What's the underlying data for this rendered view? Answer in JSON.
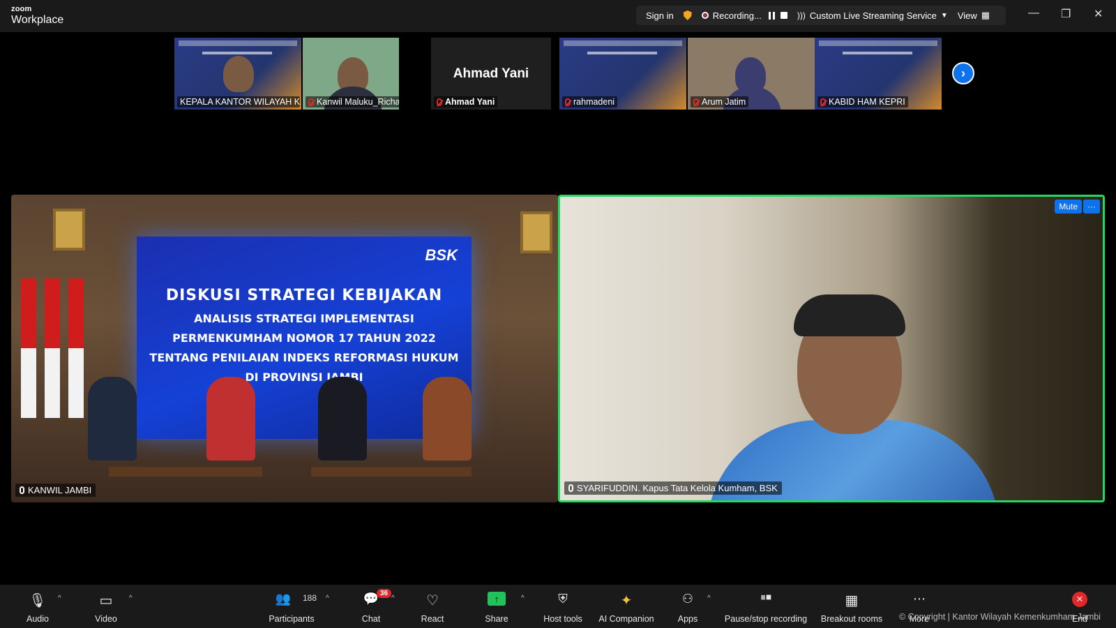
{
  "app": {
    "brand_top": "zoom",
    "brand_bottom": "Workplace"
  },
  "topbar": {
    "signin": "Sign in",
    "recording": "Recording...",
    "stream": "Custom Live Streaming Service",
    "view": "View"
  },
  "thumbnails": [
    {
      "name": "KEPALA KANTOR WILAYAH K...",
      "kind": "slide"
    },
    {
      "name": "Kanwil Maluku_Richard N...",
      "kind": "person"
    },
    {
      "name": "Ahmad Yani",
      "kind": "text",
      "display": "Ahmad Yani"
    },
    {
      "name": "rahmadeni",
      "kind": "slide"
    },
    {
      "name": "Arum Jatim",
      "kind": "person"
    },
    {
      "name": "KABID HAM KEPRI",
      "kind": "slide"
    }
  ],
  "main_left": {
    "name": "KANWIL JAMBI",
    "slide": {
      "brand": "BSK",
      "line1": "DISKUSI STRATEGI KEBIJAKAN",
      "line2": "ANALISIS STRATEGI IMPLEMENTASI",
      "line3": "PERMENKUMHAM NOMOR 17 TAHUN 2022",
      "line4": "TENTANG PENILAIAN INDEKS REFORMASI HUKUM",
      "line5": "DI PROVINSI JAMBI"
    }
  },
  "main_right": {
    "name": "SYARIFUDDIN. Kapus Tata Kelola Kumham, BSK",
    "mute_label": "Mute",
    "more_label": "···"
  },
  "toolbar": {
    "audio": "Audio",
    "video": "Video",
    "participants": "Participants",
    "participants_count": "188",
    "chat": "Chat",
    "chat_badge": "36",
    "react": "React",
    "share": "Share",
    "host_tools": "Host tools",
    "ai_companion": "AI Companion",
    "apps": "Apps",
    "pause_stop": "Pause/stop recording",
    "breakout": "Breakout rooms",
    "more": "More",
    "end": "End"
  },
  "watermark": "© Copyright | Kantor Wilayah Kemenkumham Jambi",
  "colors": {
    "accent": "#0e72ed",
    "active_speaker": "#23d95f",
    "danger": "#e02828",
    "share": "#23c15a"
  }
}
